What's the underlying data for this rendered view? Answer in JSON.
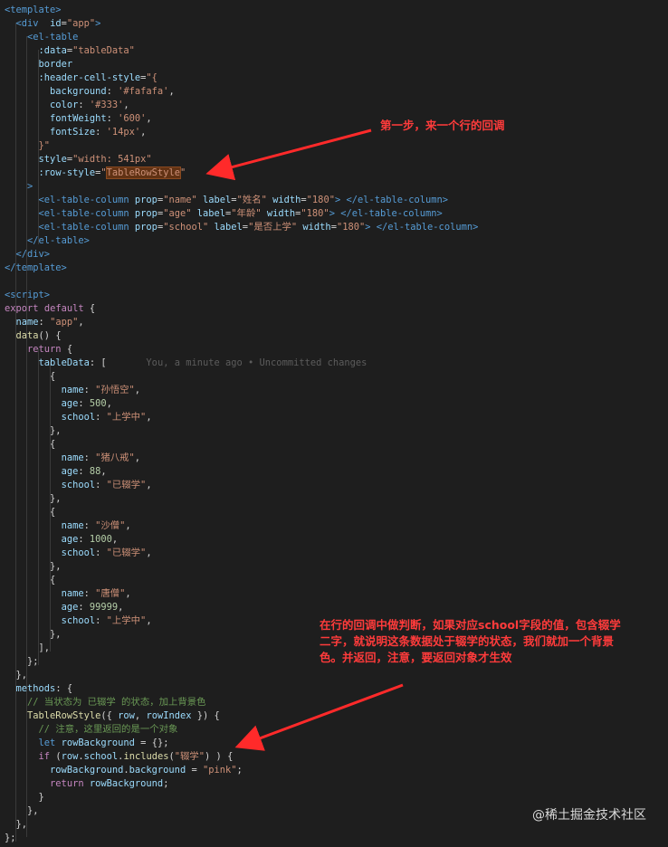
{
  "editor": {
    "lines": [
      [
        [
          "t-tag",
          "<template>"
        ]
      ],
      [
        [
          "",
          "  "
        ],
        [
          "t-tag",
          "<div"
        ],
        [
          "",
          "  "
        ],
        [
          "t-attr",
          "id"
        ],
        [
          "",
          "="
        ],
        [
          "t-str",
          "\"app\""
        ],
        [
          "t-tag",
          ">"
        ]
      ],
      [
        [
          "",
          "    "
        ],
        [
          "t-tag",
          "<el-table"
        ]
      ],
      [
        [
          "",
          "      "
        ],
        [
          "t-attr",
          ":data"
        ],
        [
          "",
          "="
        ],
        [
          "t-str",
          "\"tableData\""
        ]
      ],
      [
        [
          "",
          "      "
        ],
        [
          "t-attr",
          "border"
        ]
      ],
      [
        [
          "",
          "      "
        ],
        [
          "t-attr",
          ":header-cell-style"
        ],
        [
          "",
          "="
        ],
        [
          "t-str",
          "\"{"
        ]
      ],
      [
        [
          "",
          "        "
        ],
        [
          "t-attr",
          "background"
        ],
        [
          "",
          ": "
        ],
        [
          "t-str",
          "'#fafafa'"
        ],
        [
          "",
          ","
        ]
      ],
      [
        [
          "",
          "        "
        ],
        [
          "t-attr",
          "color"
        ],
        [
          "",
          ": "
        ],
        [
          "t-str",
          "'#333'"
        ],
        [
          "",
          ","
        ]
      ],
      [
        [
          "",
          "        "
        ],
        [
          "t-attr",
          "fontWeight"
        ],
        [
          "",
          ": "
        ],
        [
          "t-str",
          "'600'"
        ],
        [
          "",
          ","
        ]
      ],
      [
        [
          "",
          "        "
        ],
        [
          "t-attr",
          "fontSize"
        ],
        [
          "",
          ": "
        ],
        [
          "t-str",
          "'14px'"
        ],
        [
          "",
          ","
        ]
      ],
      [
        [
          "",
          "      "
        ],
        [
          "t-str",
          "}\""
        ]
      ],
      [
        [
          "",
          "      "
        ],
        [
          "t-attr",
          "style"
        ],
        [
          "",
          "="
        ],
        [
          "t-str",
          "\"width: 541px\""
        ]
      ],
      [
        [
          "",
          "      "
        ],
        [
          "t-attr",
          ":row-style"
        ],
        [
          "",
          "="
        ],
        [
          "t-str",
          "\""
        ],
        [
          "t-str hl",
          "TableRowStyle"
        ],
        [
          "t-str",
          "\""
        ]
      ],
      [
        [
          "",
          "    "
        ],
        [
          "t-tag",
          ">"
        ]
      ],
      [
        [
          "",
          "      "
        ],
        [
          "t-tag",
          "<el-table-column"
        ],
        [
          "",
          " "
        ],
        [
          "t-attr",
          "prop"
        ],
        [
          "",
          "="
        ],
        [
          "t-str",
          "\"name\""
        ],
        [
          "",
          " "
        ],
        [
          "t-attr",
          "label"
        ],
        [
          "",
          "="
        ],
        [
          "t-str",
          "\"姓名\""
        ],
        [
          "",
          " "
        ],
        [
          "t-attr",
          "width"
        ],
        [
          "",
          "="
        ],
        [
          "t-str",
          "\"180\""
        ],
        [
          "t-tag",
          "> </el-table-column>"
        ]
      ],
      [
        [
          "",
          "      "
        ],
        [
          "t-tag",
          "<el-table-column"
        ],
        [
          "",
          " "
        ],
        [
          "t-attr",
          "prop"
        ],
        [
          "",
          "="
        ],
        [
          "t-str",
          "\"age\""
        ],
        [
          "",
          " "
        ],
        [
          "t-attr",
          "label"
        ],
        [
          "",
          "="
        ],
        [
          "t-str",
          "\"年龄\""
        ],
        [
          "",
          " "
        ],
        [
          "t-attr",
          "width"
        ],
        [
          "",
          "="
        ],
        [
          "t-str",
          "\"180\""
        ],
        [
          "t-tag",
          "> </el-table-column>"
        ]
      ],
      [
        [
          "",
          "      "
        ],
        [
          "t-tag",
          "<el-table-column"
        ],
        [
          "",
          " "
        ],
        [
          "t-attr",
          "prop"
        ],
        [
          "",
          "="
        ],
        [
          "t-str",
          "\"school\""
        ],
        [
          "",
          " "
        ],
        [
          "t-attr",
          "label"
        ],
        [
          "",
          "="
        ],
        [
          "t-str",
          "\"是否上学\""
        ],
        [
          "",
          " "
        ],
        [
          "t-attr",
          "width"
        ],
        [
          "",
          "="
        ],
        [
          "t-str",
          "\"180\""
        ],
        [
          "t-tag",
          "> </el-table-column>"
        ]
      ],
      [
        [
          "",
          "    "
        ],
        [
          "t-tag",
          "</el-table>"
        ]
      ],
      [
        [
          "",
          "  "
        ],
        [
          "t-tag",
          "</div>"
        ]
      ],
      [
        [
          "t-tag",
          "</template>"
        ]
      ],
      [
        [
          "",
          ""
        ]
      ],
      [
        [
          "t-tag",
          "<script>"
        ]
      ],
      [
        [
          "t-ctrl",
          "export"
        ],
        [
          "",
          " "
        ],
        [
          "t-ctrl",
          "default"
        ],
        [
          "",
          " {"
        ]
      ],
      [
        [
          "",
          "  "
        ],
        [
          "t-attr",
          "name"
        ],
        [
          "",
          ": "
        ],
        [
          "t-str",
          "\"app\""
        ],
        [
          "",
          ","
        ]
      ],
      [
        [
          "",
          "  "
        ],
        [
          "t-fn",
          "data"
        ],
        [
          "",
          "() {"
        ]
      ],
      [
        [
          "",
          "    "
        ],
        [
          "t-ctrl",
          "return"
        ],
        [
          "",
          " {"
        ]
      ],
      [
        [
          "",
          "      "
        ],
        [
          "t-attr",
          "tableData"
        ],
        [
          "",
          ": ["
        ],
        [
          "t-blame",
          "       You, a minute ago • Uncommitted changes"
        ]
      ],
      [
        [
          "",
          "        {"
        ]
      ],
      [
        [
          "",
          "          "
        ],
        [
          "t-attr",
          "name"
        ],
        [
          "",
          ": "
        ],
        [
          "t-str",
          "\"孙悟空\""
        ],
        [
          "",
          ","
        ]
      ],
      [
        [
          "",
          "          "
        ],
        [
          "t-attr",
          "age"
        ],
        [
          "",
          ": "
        ],
        [
          "t-num",
          "500"
        ],
        [
          "",
          ","
        ]
      ],
      [
        [
          "",
          "          "
        ],
        [
          "t-attr",
          "school"
        ],
        [
          "",
          ": "
        ],
        [
          "t-str",
          "\"上学中\""
        ],
        [
          "",
          ","
        ]
      ],
      [
        [
          "",
          "        },"
        ]
      ],
      [
        [
          "",
          "        {"
        ]
      ],
      [
        [
          "",
          "          "
        ],
        [
          "t-attr",
          "name"
        ],
        [
          "",
          ": "
        ],
        [
          "t-str",
          "\"猪八戒\""
        ],
        [
          "",
          ","
        ]
      ],
      [
        [
          "",
          "          "
        ],
        [
          "t-attr",
          "age"
        ],
        [
          "",
          ": "
        ],
        [
          "t-num",
          "88"
        ],
        [
          "",
          ","
        ]
      ],
      [
        [
          "",
          "          "
        ],
        [
          "t-attr",
          "school"
        ],
        [
          "",
          ": "
        ],
        [
          "t-str",
          "\"已辍学\""
        ],
        [
          "",
          ","
        ]
      ],
      [
        [
          "",
          "        },"
        ]
      ],
      [
        [
          "",
          "        {"
        ]
      ],
      [
        [
          "",
          "          "
        ],
        [
          "t-attr",
          "name"
        ],
        [
          "",
          ": "
        ],
        [
          "t-str",
          "\"沙僧\""
        ],
        [
          "",
          ","
        ]
      ],
      [
        [
          "",
          "          "
        ],
        [
          "t-attr",
          "age"
        ],
        [
          "",
          ": "
        ],
        [
          "t-num",
          "1000"
        ],
        [
          "",
          ","
        ]
      ],
      [
        [
          "",
          "          "
        ],
        [
          "t-attr",
          "school"
        ],
        [
          "",
          ": "
        ],
        [
          "t-str",
          "\"已辍学\""
        ],
        [
          "",
          ","
        ]
      ],
      [
        [
          "",
          "        },"
        ]
      ],
      [
        [
          "",
          "        {"
        ]
      ],
      [
        [
          "",
          "          "
        ],
        [
          "t-attr",
          "name"
        ],
        [
          "",
          ": "
        ],
        [
          "t-str",
          "\"唐僧\""
        ],
        [
          "",
          ","
        ]
      ],
      [
        [
          "",
          "          "
        ],
        [
          "t-attr",
          "age"
        ],
        [
          "",
          ": "
        ],
        [
          "t-num",
          "99999"
        ],
        [
          "",
          ","
        ]
      ],
      [
        [
          "",
          "          "
        ],
        [
          "t-attr",
          "school"
        ],
        [
          "",
          ": "
        ],
        [
          "t-str",
          "\"上学中\""
        ],
        [
          "",
          ","
        ]
      ],
      [
        [
          "",
          "        },"
        ]
      ],
      [
        [
          "",
          "      ],"
        ]
      ],
      [
        [
          "",
          "    };"
        ]
      ],
      [
        [
          "",
          "  },"
        ]
      ],
      [
        [
          "",
          "  "
        ],
        [
          "t-attr",
          "methods"
        ],
        [
          "",
          ": {"
        ]
      ],
      [
        [
          "",
          "    "
        ],
        [
          "t-com",
          "// 当状态为 已辍学 的状态，加上背景色"
        ]
      ],
      [
        [
          "",
          "    "
        ],
        [
          "t-fn",
          "TableRowStyle"
        ],
        [
          "",
          "({ "
        ],
        [
          "t-attr",
          "row"
        ],
        [
          "",
          ", "
        ],
        [
          "t-attr",
          "rowIndex"
        ],
        [
          "",
          " }) {"
        ]
      ],
      [
        [
          "",
          "      "
        ],
        [
          "t-com",
          "// 注意，这里返回的是一个对象"
        ]
      ],
      [
        [
          "",
          "      "
        ],
        [
          "t-kw",
          "let"
        ],
        [
          "",
          " "
        ],
        [
          "t-attr",
          "rowBackground"
        ],
        [
          "",
          " = {};"
        ]
      ],
      [
        [
          "",
          "      "
        ],
        [
          "t-ctrl",
          "if"
        ],
        [
          "",
          " ("
        ],
        [
          "t-attr",
          "row"
        ],
        [
          "",
          "."
        ],
        [
          "t-attr",
          "school"
        ],
        [
          "",
          "."
        ],
        [
          "t-fn",
          "includes"
        ],
        [
          "",
          "("
        ],
        [
          "t-str",
          "\"辍学\""
        ],
        [
          "",
          ") ) {"
        ]
      ],
      [
        [
          "",
          "        "
        ],
        [
          "t-attr",
          "rowBackground"
        ],
        [
          "",
          "."
        ],
        [
          "t-attr",
          "background"
        ],
        [
          "",
          " = "
        ],
        [
          "t-str",
          "\"pink\""
        ],
        [
          "",
          ";"
        ]
      ],
      [
        [
          "",
          "        "
        ],
        [
          "t-ctrl",
          "return"
        ],
        [
          "",
          " "
        ],
        [
          "t-attr",
          "rowBackground"
        ],
        [
          "",
          ";"
        ]
      ],
      [
        [
          "",
          "      }"
        ]
      ],
      [
        [
          "",
          "    },"
        ]
      ],
      [
        [
          "",
          "  },"
        ]
      ],
      [
        [
          "",
          "};"
        ]
      ]
    ]
  },
  "annotations": {
    "step1": "第一步，来一个行的回调",
    "step2_line1": "在行的回调中做判断，如果对应school字段的值，包含辍学",
    "step2_line2": "二字，就说明这条数据处于辍学的状态，我们就加一个背景",
    "step2_line3": "色。并返回，注意，要返回对象才生效"
  },
  "watermark": "@稀土掘金技术社区",
  "colors": {
    "background": "#1e1e1e",
    "annotation_red": "#ff3b3b",
    "tag_blue": "#569cd6",
    "attr_lightblue": "#9cdcfe",
    "string_orange": "#ce9178",
    "comment_green": "#6a9955"
  }
}
